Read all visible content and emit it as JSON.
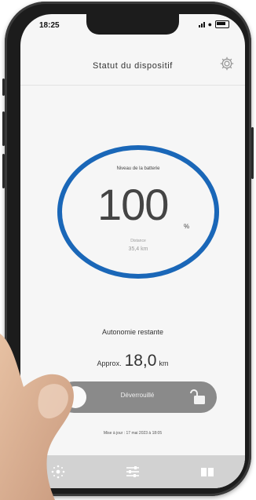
{
  "status_bar": {
    "time": "18:25"
  },
  "header": {
    "title": "Statut du dispositif",
    "settings_icon": "gear-icon"
  },
  "battery": {
    "caption": "Niveau de la batterie",
    "percent": "100",
    "unit": "%",
    "level_fraction": 1.0,
    "sub_label": "Distance",
    "sub_value": "35,4 km",
    "ring_color": "#1a67b8"
  },
  "range": {
    "label": "Autonomie restante",
    "approx": "Approx.",
    "value": "18,0",
    "unit": "km"
  },
  "unlock": {
    "label": "Déverrouillé",
    "icon": "unlock-icon"
  },
  "update": {
    "text": "Mise à jour : 17 mai 2023 à 18:05"
  },
  "tabs": [
    {
      "name": "tab-device-status",
      "icon": "radial-dots-icon"
    },
    {
      "name": "tab-settings",
      "icon": "sliders-icon"
    },
    {
      "name": "tab-manual",
      "icon": "book-icon"
    }
  ]
}
